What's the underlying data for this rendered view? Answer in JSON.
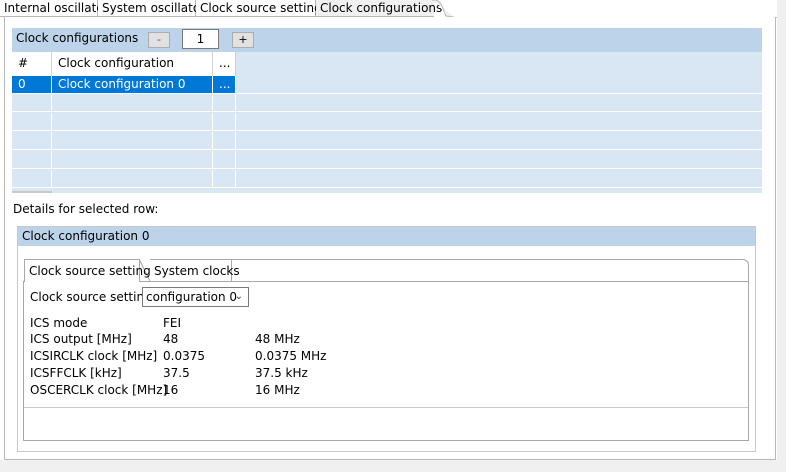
{
  "top_tabs": [
    {
      "label": "Internal oscillator",
      "active": false
    },
    {
      "label": "System oscillator",
      "active": false
    },
    {
      "label": "Clock source settings",
      "active": false
    },
    {
      "label": "Clock configurations",
      "active": true
    }
  ],
  "configurations_panel": {
    "title": "Clock configurations",
    "minus_label": "-",
    "count": "1",
    "plus_label": "+",
    "columns": [
      "#",
      "Clock configuration",
      "..."
    ],
    "rows": [
      {
        "index": "0",
        "name": "Clock configuration 0",
        "more": "..."
      }
    ]
  },
  "details_label": "Details for selected row:",
  "details": {
    "title": "Clock configuration 0",
    "tabs": [
      "Clock source setting",
      "System clocks"
    ],
    "clock_source_label": "Clock source setting",
    "clock_source_value": "configuration 0",
    "properties": [
      {
        "name": "ICS mode",
        "value": "FEI",
        "unit_value": ""
      },
      {
        "name": "ICS output [MHz]",
        "value": "48",
        "unit_value": "48 MHz"
      },
      {
        "name": "ICSIRCLK clock [MHz]",
        "value": "0.0375",
        "unit_value": "0.0375 MHz"
      },
      {
        "name": "ICSFFCLK [kHz]",
        "value": "37.5",
        "unit_value": "37.5 kHz"
      },
      {
        "name": "OSCERCLK clock [MHz]",
        "value": "16",
        "unit_value": "16 MHz"
      }
    ]
  },
  "colors": {
    "header_blue": "#bcd3ea",
    "selection_blue": "#0078d7",
    "grid_row_blue": "#d9e6f4"
  }
}
